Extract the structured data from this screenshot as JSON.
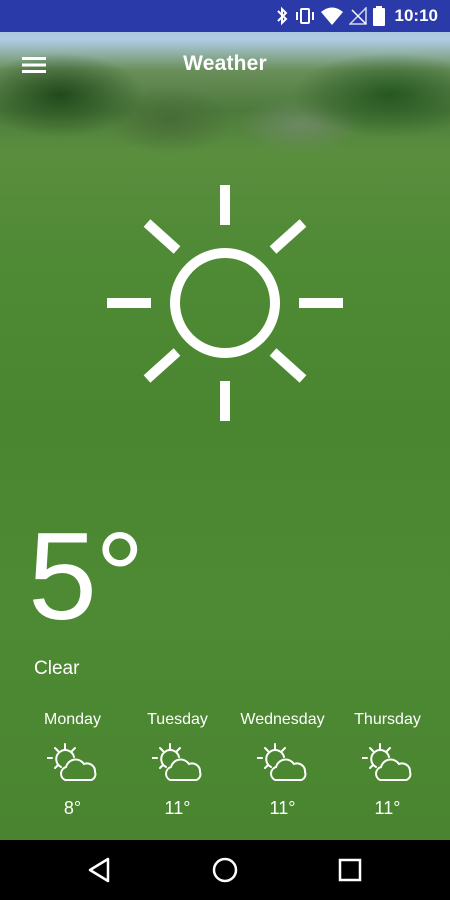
{
  "status_bar": {
    "time": "10:10",
    "icons": [
      "bluetooth-icon",
      "vibrate-icon",
      "wifi-icon",
      "no-signal-icon",
      "battery-icon"
    ]
  },
  "app_bar": {
    "title": "Weather",
    "menu_icon": "hamburger-menu-icon"
  },
  "current": {
    "icon": "sun-icon",
    "temperature": "5°",
    "condition": "Clear"
  },
  "forecast": [
    {
      "day": "Monday",
      "temp": "8°",
      "icon": "partly-cloudy-icon"
    },
    {
      "day": "Tuesday",
      "temp": "11°",
      "icon": "partly-cloudy-icon"
    },
    {
      "day": "Wednesday",
      "temp": "11°",
      "icon": "partly-cloudy-icon"
    },
    {
      "day": "Thursday",
      "temp": "11°",
      "icon": "partly-cloudy-icon"
    }
  ],
  "nav_bar": {
    "buttons": [
      "back-icon",
      "home-icon",
      "recents-icon"
    ]
  },
  "colors": {
    "status_bar": "#2a3aa8",
    "nav_bar": "#000000",
    "foreground": "#ffffff"
  }
}
